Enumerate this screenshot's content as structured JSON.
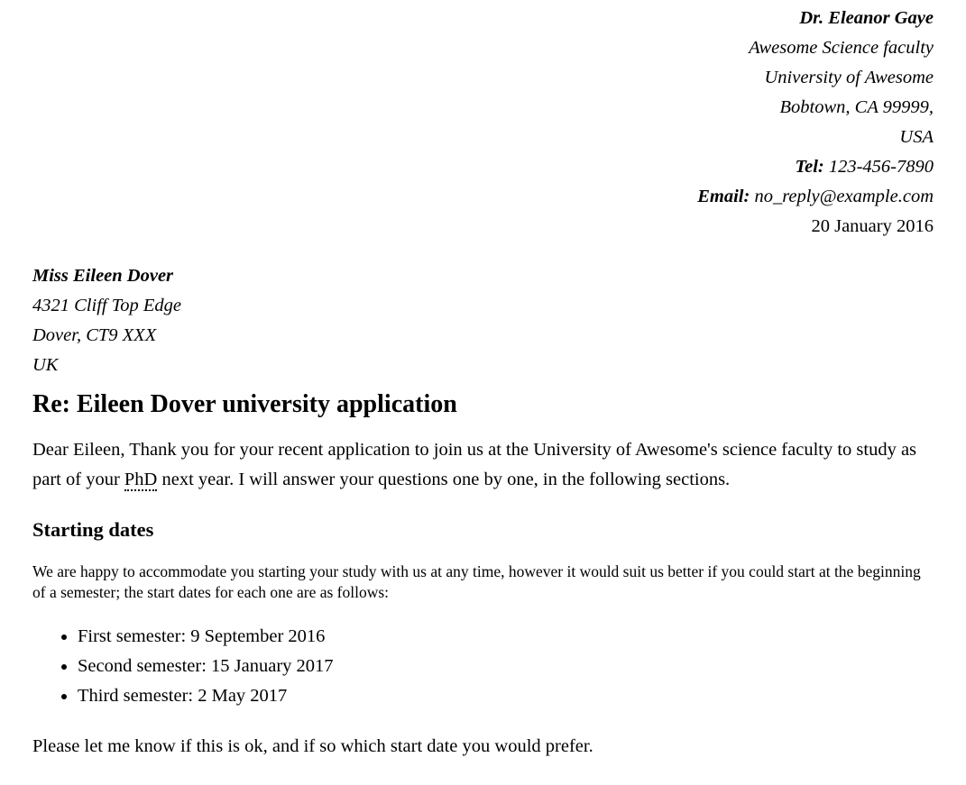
{
  "sender": {
    "name": "Dr. Eleanor Gaye",
    "department": "Awesome Science faculty",
    "university": "University of Awesome",
    "city": "Bobtown, CA 99999,",
    "country": "USA",
    "tel_label": "Tel:",
    "tel_value": "123-456-7890",
    "email_label": "Email:",
    "email_value": "no_reply@example.com",
    "date": "20 January 2016"
  },
  "recipient": {
    "name": "Miss Eileen Dover",
    "street": "4321 Cliff Top Edge",
    "city": "Dover, CT9 XXX",
    "country": "UK"
  },
  "letter": {
    "heading": "Re: Eileen Dover university application",
    "intro_part1": "Dear Eileen, Thank you for your recent application to join us at the University of Awesome's science faculty to study as part of your ",
    "intro_abbr": "PhD",
    "intro_part2": " next year. I will answer your questions one by one, in the following sections.",
    "section_heading": "Starting dates",
    "section_text": "We are happy to accommodate you starting your study with us at any time, however it would suit us better if you could start at the beginning of a semester; the start dates for each one are as follows:",
    "dates": [
      "First semester: 9 September 2016",
      "Second semester: 15 January 2017",
      "Third semester: 2 May 2017"
    ],
    "closing": "Please let me know if this is ok, and if so which start date you would prefer."
  }
}
